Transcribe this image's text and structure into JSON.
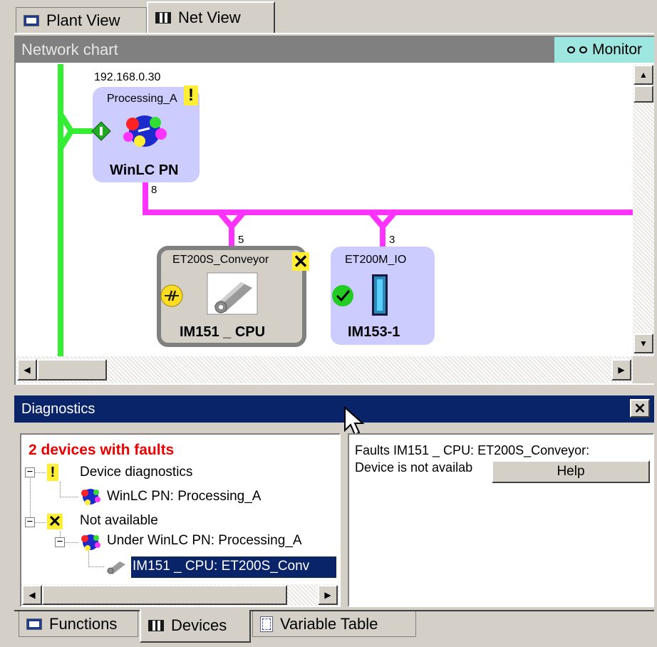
{
  "tabs_top": [
    {
      "label": "Plant View",
      "icon": "plant-view-icon",
      "active": false
    },
    {
      "label": "Net View",
      "icon": "net-view-icon",
      "active": true
    }
  ],
  "chart": {
    "title": "Network chart",
    "monitor_label": "Monitor",
    "colors": {
      "profinet_line": "#ff33ff",
      "ethernet_line": "#33ee33",
      "node_fill": "#ccccff"
    }
  },
  "nodes": {
    "winlc": {
      "ip": "192.168.0.30",
      "name": "Processing_A",
      "type": "WinLC PN",
      "status": "warning",
      "port_label": "8"
    },
    "conveyor": {
      "name": "ET200S_Conveyor",
      "type": "IM151 _ CPU",
      "status": "not-available",
      "port_label": "5"
    },
    "io": {
      "name": "ET200M_IO",
      "type": "IM153-1",
      "status": "ok",
      "port_label": "3"
    }
  },
  "diagnostics": {
    "title": "Diagnostics",
    "summary": "2 devices with faults",
    "tree": {
      "device_diag": "Device diagnostics",
      "device_diag_child": "WinLC PN: Processing_A",
      "not_available": "Not available",
      "under": "Under WinLC PN: Processing_A",
      "selected": "IM151 _ CPU: ET200S_Conv"
    },
    "detail_line1": "Faults IM151 _ CPU: ET200S_Conveyor:",
    "detail_line2": "Device is not availab",
    "help_button": "Help"
  },
  "tabs_bottom": [
    {
      "label": "Functions",
      "icon": "functions-icon",
      "active": false
    },
    {
      "label": "Devices",
      "icon": "devices-icon",
      "active": true
    },
    {
      "label": "Variable Table",
      "icon": "variable-table-icon",
      "active": false
    }
  ]
}
